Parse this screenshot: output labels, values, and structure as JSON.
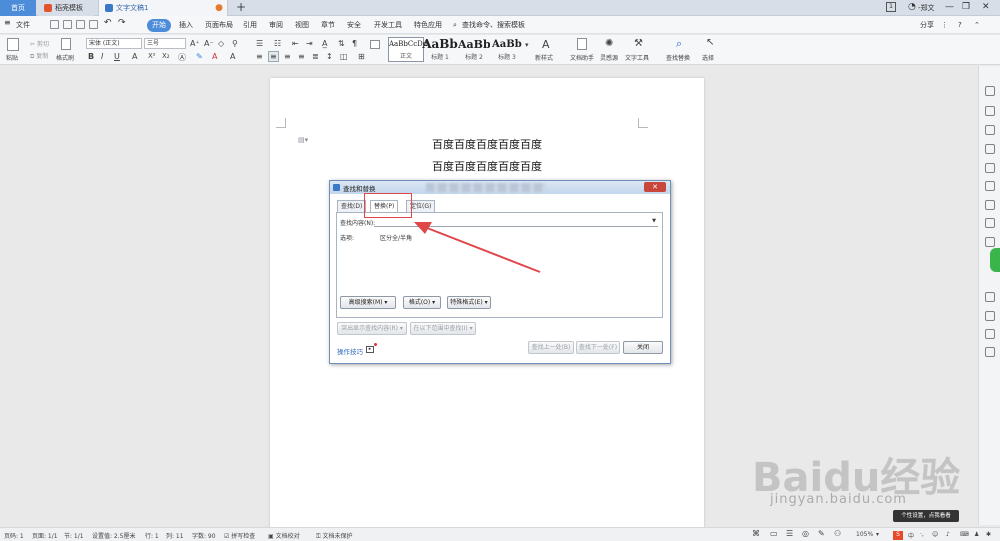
{
  "titlebar": {
    "tabs": [
      {
        "label": "首页"
      },
      {
        "label": "稻壳模板"
      },
      {
        "label": "文字文稿1"
      }
    ],
    "badge": "1",
    "user": "-郑文"
  },
  "menubar": {
    "file": "文件",
    "items": [
      "开始",
      "插入",
      "页面布局",
      "引用",
      "审阅",
      "视图",
      "章节",
      "安全",
      "开发工具",
      "特色应用"
    ],
    "search_placeholder": "查找命令、搜索模板",
    "share": "分享"
  },
  "ribbon": {
    "paste": "粘贴",
    "cut": "剪切",
    "copy": "复制",
    "format_painter": "格式刷",
    "font_name": "宋体 (正文)",
    "font_size": "三号",
    "styles": [
      {
        "preview": "AaBbCcDd",
        "caption": "正文"
      },
      {
        "preview": "AaBb",
        "caption": "标题 1"
      },
      {
        "preview": "AaBbC",
        "caption": "标题 2"
      },
      {
        "preview": "AaBbC",
        "caption": "标题 3"
      }
    ],
    "new_style": "新样式",
    "doc_helper": "文档助手",
    "inspiration": "灵感源",
    "text_tools": "文字工具",
    "find_replace": "查找替换",
    "select": "选择"
  },
  "document": {
    "lines": [
      "百度百度百度百度百度",
      "百度百度百度百度百度"
    ]
  },
  "dialog": {
    "title": "查找和替换",
    "tabs": [
      "查找(D)",
      "替换(P)",
      "定位(G)"
    ],
    "find_label": "查找内容(N):",
    "options_label": "选项:",
    "options_value": "区分全/半角",
    "buttons": {
      "advanced": "高级搜索(M) ▾",
      "format": "格式(O) ▾",
      "special": "特殊格式(E) ▾",
      "highlight_all": "突出显示查找内容(R) ▾",
      "find_in": "在以下范围中查找(I) ▾",
      "find_prev": "查找上一处(B)",
      "find_next": "查找下一处(F)",
      "close": "关闭"
    },
    "tips_link": "操作技巧"
  },
  "statusbar": {
    "page": "页码: 1",
    "pages": "页面: 1/1",
    "section": "节: 1/1",
    "setting": "设置值: 2.5厘米",
    "row": "行: 1",
    "col": "列: 11",
    "words": "字数: 90",
    "spell": "拼写检查",
    "proof": "文档校对",
    "protect": "文档未保护",
    "zoom": "105%",
    "tooltip": "个性设置，点我看看"
  },
  "watermark": {
    "brand": "Baidu经验",
    "url": "jingyan.baidu.com"
  },
  "colors": {
    "accent": "#4d8cd9",
    "annotation": "#e0474a"
  }
}
